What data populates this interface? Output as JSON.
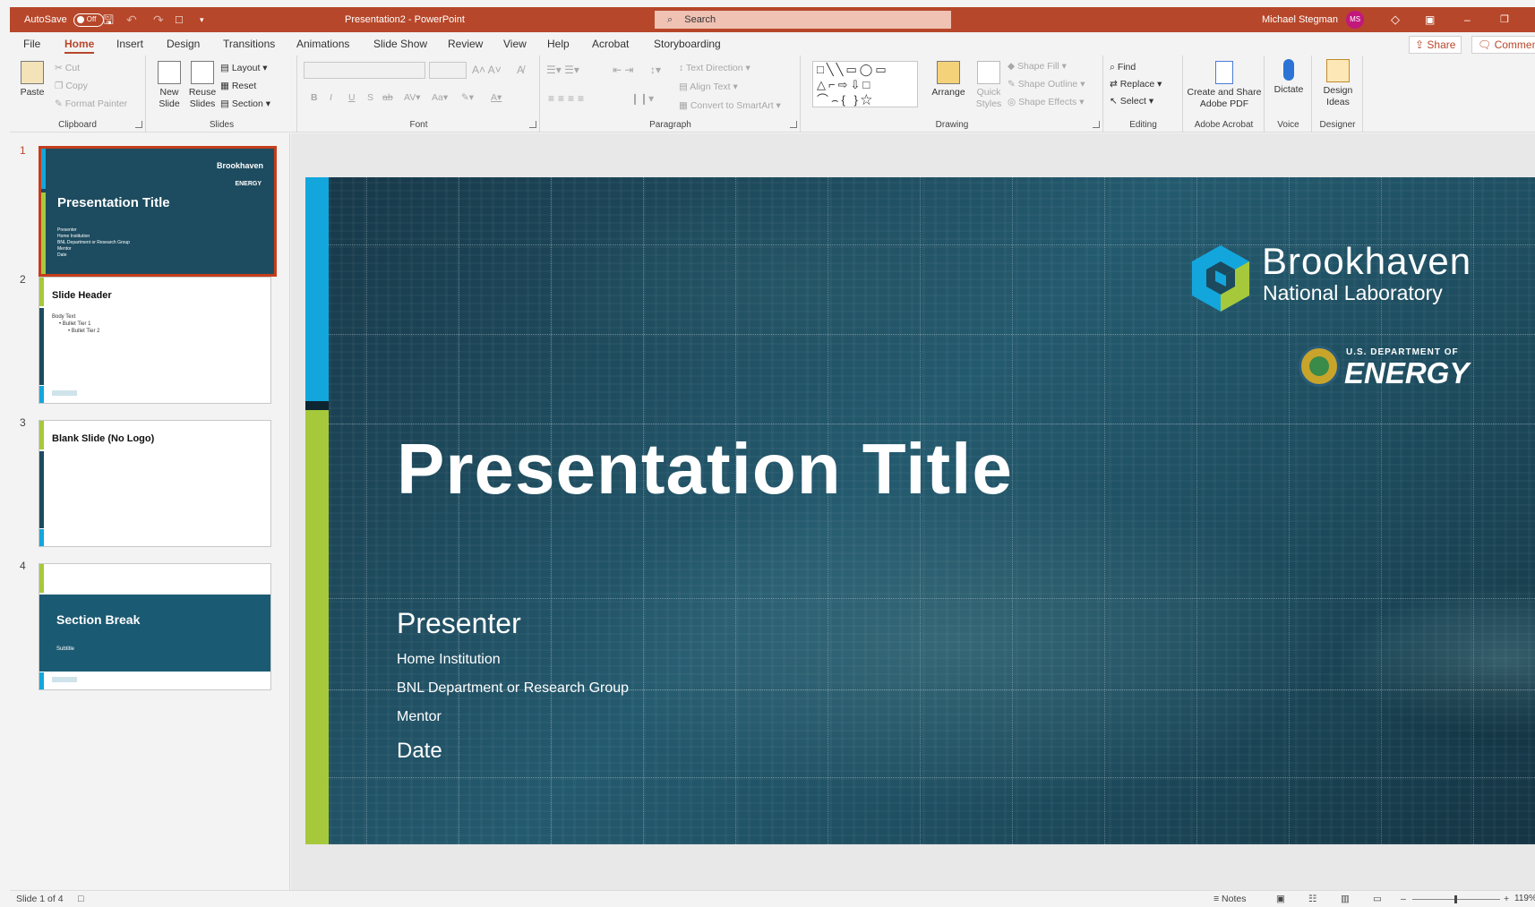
{
  "titlebar": {
    "autosave_label": "AutoSave",
    "autosave_state": "Off",
    "doc_title": "Presentation2  -  PowerPoint",
    "search_placeholder": "Search",
    "user_name": "Michael Stegman",
    "user_initials": "MS"
  },
  "menu": {
    "tabs": [
      "File",
      "Home",
      "Insert",
      "Design",
      "Transitions",
      "Animations",
      "Slide Show",
      "Review",
      "View",
      "Help",
      "Acrobat",
      "Storyboarding"
    ],
    "active_tab": "Home",
    "share_label": "Share",
    "comments_label": "Comments"
  },
  "ribbon": {
    "clipboard": {
      "paste": "Paste",
      "cut": "Cut",
      "copy": "Copy",
      "format_painter": "Format Painter",
      "label": "Clipboard"
    },
    "slides": {
      "new_slide": "New Slide",
      "reuse_slides": "Reuse Slides",
      "layout": "Layout",
      "reset": "Reset",
      "section": "Section",
      "label": "Slides"
    },
    "font": {
      "label": "Font",
      "bold": "B",
      "italic": "I",
      "underline": "U",
      "strike": "S",
      "case": "Aa"
    },
    "paragraph": {
      "text_direction": "Text Direction",
      "align_text": "Align Text",
      "convert_smartart": "Convert to SmartArt",
      "label": "Paragraph"
    },
    "drawing": {
      "arrange": "Arrange",
      "quick_styles": "Quick Styles",
      "shape_fill": "Shape Fill",
      "shape_outline": "Shape Outline",
      "shape_effects": "Shape Effects",
      "label": "Drawing"
    },
    "editing": {
      "find": "Find",
      "replace": "Replace",
      "select": "Select",
      "label": "Editing"
    },
    "acrobat": {
      "create_share": "Create and Share Adobe PDF",
      "label": "Adobe Acrobat"
    },
    "voice": {
      "dictate": "Dictate",
      "label": "Voice"
    },
    "designer": {
      "design_ideas": "Design Ideas",
      "label": "Designer"
    }
  },
  "thumbnails": [
    {
      "number": "1",
      "title": "Presentation Title",
      "lines": [
        "Presenter",
        "Home Institution",
        "BNL Department or Research Group",
        "Mentor",
        "Date"
      ],
      "selected": true
    },
    {
      "number": "2",
      "title": "Slide Header",
      "lines": [
        "Body Text",
        "• Bullet Tier 1",
        "• Bullet Tier 2"
      ],
      "selected": false
    },
    {
      "number": "3",
      "title": "Blank Slide (No Logo)",
      "lines": [],
      "selected": false
    },
    {
      "number": "4",
      "title": "Section Break",
      "lines": [
        "Subtitle"
      ],
      "selected": false
    }
  ],
  "slide": {
    "logo_name": "Brookhaven",
    "logo_sub": "National Laboratory",
    "doe_top": "U.S. DEPARTMENT OF",
    "doe_main": "ENERGY",
    "title": "Presentation Title",
    "presenter": "Presenter",
    "home_institution": "Home Institution",
    "department": "BNL Department or Research Group",
    "mentor": "Mentor",
    "date": "Date"
  },
  "status": {
    "slide_counter": "Slide 1 of 4",
    "notes": "Notes",
    "zoom": "119%"
  },
  "colors": {
    "accent": "#b7472a",
    "slide_bg": "#1b4a5e",
    "brand_blue": "#13a6dd",
    "brand_green": "#a6c93b",
    "section_band": "#1a5a72"
  }
}
